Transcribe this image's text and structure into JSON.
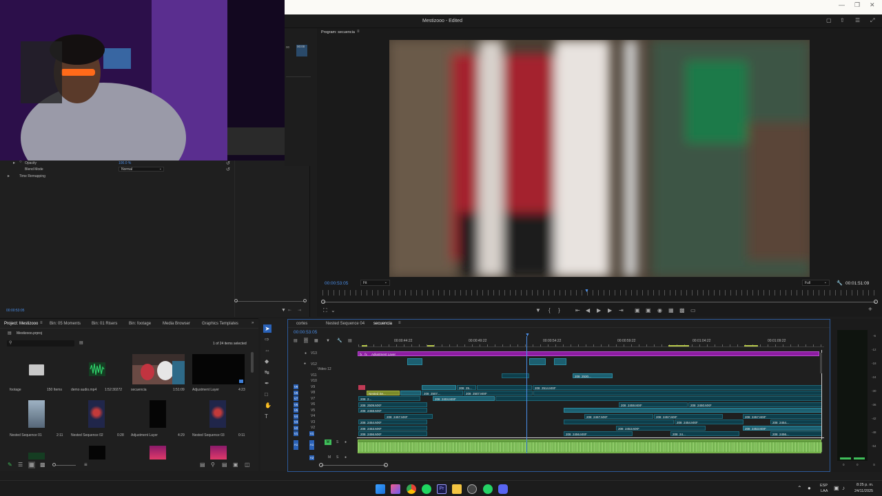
{
  "app": {
    "title": "Mestizooo - Edited"
  },
  "effect_controls": {
    "opacity_label": "Opacity",
    "opacity_value": "100.0 %",
    "blend_label": "Blend Mode",
    "blend_value": "Normal",
    "time_remap_label": "Time Remapping",
    "timecode": "00:00:53:05",
    "src_tc_a": "00",
    "src_tc_b": "00:00"
  },
  "program": {
    "title": "Program: secuencia",
    "timecode": "00:00:53:05",
    "fit": "Fit",
    "quality": "Full",
    "duration": "00:01:51:09"
  },
  "project": {
    "tabs": [
      "Project: Mestizooo",
      "Bin: 05 Moments",
      "Bin: 01 Risers",
      "Bin: footage",
      "Media Browser",
      "Graphics Templates"
    ],
    "file": "Mestizooo.prproj",
    "selection": "1 of 24 items selected",
    "items": [
      {
        "name": "footage",
        "meta": "150 Items"
      },
      {
        "name": "demo audio.mp4",
        "meta": "1:52:30272"
      },
      {
        "name": "secuencia",
        "meta": "1:51:09"
      },
      {
        "name": "Adjustment Layer",
        "meta": "4:23"
      },
      {
        "name": "Nested Sequence 01",
        "meta": "2:11"
      },
      {
        "name": "Nested Sequence 02",
        "meta": "0:28"
      },
      {
        "name": "Adjustment Layer",
        "meta": "4:29"
      },
      {
        "name": "Nested Sequence 03",
        "meta": "0:11"
      }
    ]
  },
  "timeline": {
    "tabs": [
      "cortes",
      "Nested Sequence 04",
      "secuencia"
    ],
    "timecode": "00:00:53:05",
    "ruler": [
      "00:00:44:22",
      "00:00:49:22",
      "00:00:54:22",
      "00:00:59:22",
      "00:01:04:22",
      "00:01:09:22"
    ],
    "video_tracks": [
      "V13",
      "V12",
      "Video 12",
      "V11",
      "V10",
      "V9",
      "V8",
      "V7",
      "V6",
      "V5",
      "V4",
      "V3",
      "V2",
      "V1"
    ],
    "audio_tracks": [
      "A1",
      "A2"
    ],
    "adj_label": "Adjustment Layer",
    "nested_label": "Nested Se...",
    "clips": {
      "c1": "208_2509.MXF",
      "c2": "208_25...",
      "c3": "208_2507...",
      "c4": "208_2507.MXF",
      "c5": "208_2514.MXF",
      "c6": "208_2404.MXF",
      "c7": "208_2...",
      "c8": "208_2459.MXF",
      "c9": "208_2458.MXF",
      "c10": "208_2457.MXF",
      "c11": "208_2454.MXF",
      "c12": "208_2453.MXF",
      "c13": "208_2456.MXF",
      "c14": "208_2459.MXF",
      "c15": "208_2450.MXF",
      "c16": "208_2457.MXF",
      "c17": "208_2457.MXF",
      "c18": "208_2454.MXF",
      "c19": "208_2453.MXF",
      "c20": "208_2456.MXF",
      "c21": "208_2455.MXF",
      "c22": "208_24...",
      "c23": "208_2454...",
      "c24": "208_2453.MXF",
      "c25": "208_2456...",
      "c26": "208_2457.MXF",
      "c27": "208_2530..."
    }
  },
  "meters": {
    "scale": [
      "-6",
      "-12",
      "-18",
      "-24",
      "-30",
      "-36",
      "-42",
      "-48",
      "-54"
    ],
    "bottom": [
      "0",
      "S"
    ]
  },
  "taskbar": {
    "lang": "ESP",
    "lang2": "LAA",
    "time": "8:25 p. m.",
    "date": "24/11/2025"
  }
}
